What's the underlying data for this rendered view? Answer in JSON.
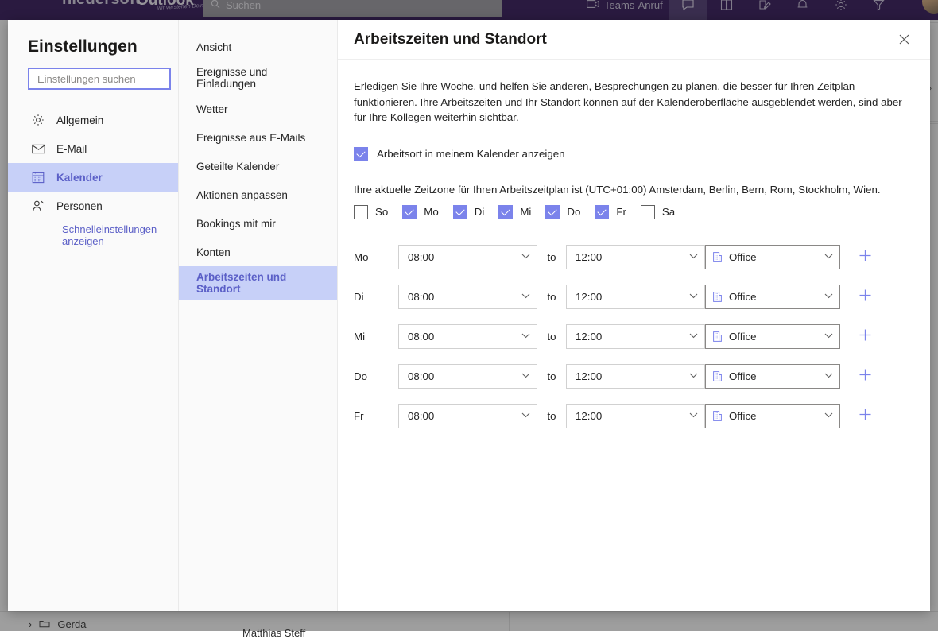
{
  "topbar": {
    "brand": "niedersoft",
    "brand_tagline": "wir verstehen Dein Land",
    "app_name": "Outlook",
    "search_placeholder": "Suchen",
    "search_icon": "search-icon",
    "teams_call_label": "Teams-Anruf",
    "icons": [
      "video-camera-icon",
      "chat-icon",
      "book-icon",
      "edit-note-icon",
      "bell-icon",
      "gear-icon",
      "filter-icon"
    ]
  },
  "background": {
    "folder_name": "Gerda",
    "message_sender": "Matthias Steff",
    "expand_icon": "chevron-right-icon",
    "folder_icon": "folder-icon",
    "expand_row_icon": "chevron-right-icon"
  },
  "settings": {
    "title": "Einstellungen",
    "search_placeholder": "Einstellungen suchen",
    "search_value": "",
    "nav_items": [
      {
        "label": "Allgemein",
        "icon": "gear-icon",
        "selected": false
      },
      {
        "label": "E-Mail",
        "icon": "envelope-icon",
        "selected": false
      },
      {
        "label": "Kalender",
        "icon": "calendar-icon",
        "selected": true
      },
      {
        "label": "Personen",
        "icon": "people-icon",
        "selected": false
      }
    ],
    "quick_settings_link": "Schnelleinstellungen anzeigen"
  },
  "sub_nav": {
    "items": [
      {
        "label": "Ansicht",
        "selected": false
      },
      {
        "label": "Ereignisse und Einladungen",
        "selected": false
      },
      {
        "label": "Wetter",
        "selected": false
      },
      {
        "label": "Ereignisse aus E-Mails",
        "selected": false
      },
      {
        "label": "Geteilte Kalender",
        "selected": false
      },
      {
        "label": "Aktionen anpassen",
        "selected": false
      },
      {
        "label": "Bookings mit mir",
        "selected": false
      },
      {
        "label": "Konten",
        "selected": false
      },
      {
        "label": "Arbeitszeiten und Standort",
        "selected": true
      }
    ]
  },
  "panel": {
    "title": "Arbeitszeiten und Standort",
    "close_icon": "close-icon",
    "intro": "Erledigen Sie Ihre Woche, und helfen Sie anderen, Besprechungen zu planen, die besser für Ihren Zeitplan funktionieren. Ihre Arbeitszeiten und Ihr Standort können auf der Kalenderoberfläche ausgeblendet werden, sind aber für Ihre Kollegen weiterhin sichtbar.",
    "show_location_label": "Arbeitsort in meinem Kalender anzeigen",
    "show_location_checked": true,
    "timezone_text": "Ihre aktuelle Zeitzone für Ihren Arbeitszeitplan ist (UTC+01:00) Amsterdam, Berlin, Bern, Rom, Stockholm, Wien.",
    "days": [
      {
        "label": "So",
        "checked": false
      },
      {
        "label": "Mo",
        "checked": true
      },
      {
        "label": "Di",
        "checked": true
      },
      {
        "label": "Mi",
        "checked": true
      },
      {
        "label": "Do",
        "checked": true
      },
      {
        "label": "Fr",
        "checked": true
      },
      {
        "label": "Sa",
        "checked": false
      }
    ],
    "to_word": "to",
    "add_icon": "plus-icon",
    "location_icon": "building-icon",
    "chevron_icon": "chevron-down-icon",
    "schedule": [
      {
        "day": "Mo",
        "start": "08:00",
        "end": "12:00",
        "location": "Office"
      },
      {
        "day": "Di",
        "start": "08:00",
        "end": "12:00",
        "location": "Office"
      },
      {
        "day": "Mi",
        "start": "08:00",
        "end": "12:00",
        "location": "Office"
      },
      {
        "day": "Do",
        "start": "08:00",
        "end": "12:00",
        "location": "Office"
      },
      {
        "day": "Fr",
        "start": "08:00",
        "end": "12:00",
        "location": "Office"
      }
    ]
  },
  "colors": {
    "accent": "#7b83eb",
    "accent_text": "#5b5fc7",
    "selected_bg": "#c7d0f8",
    "topbar": "#2d0f54"
  }
}
